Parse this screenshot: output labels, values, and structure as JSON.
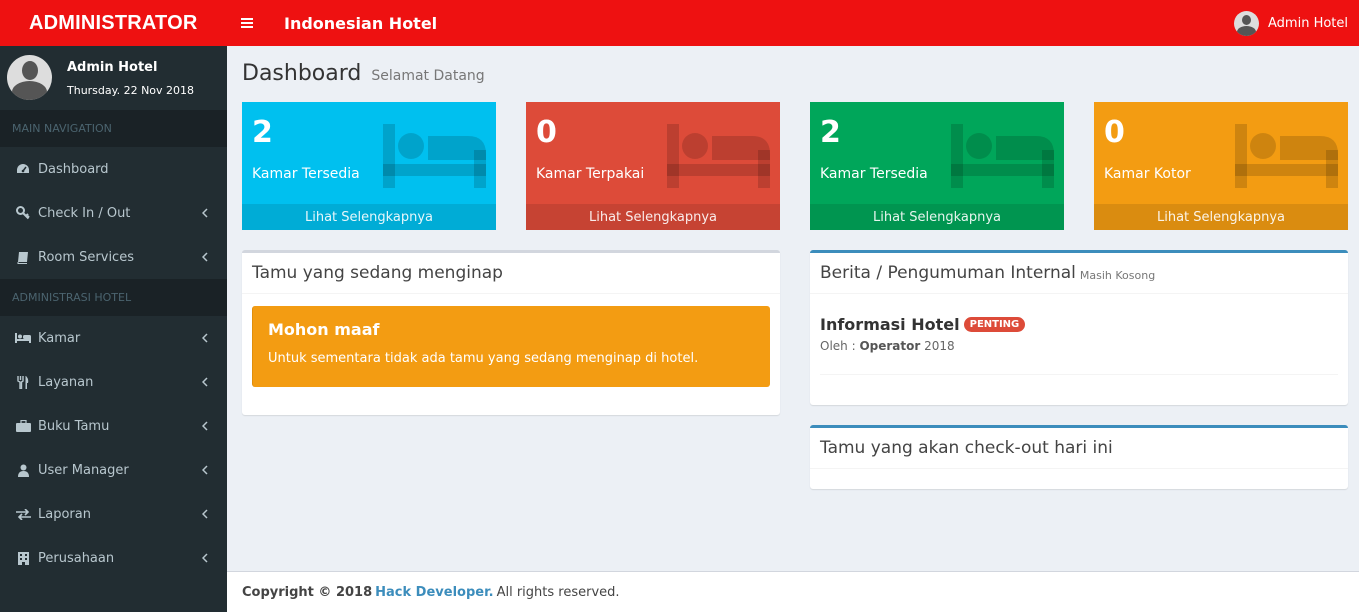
{
  "header": {
    "logo": "ADMINISTRATOR",
    "brand": "Indonesian Hotel",
    "user_name": "Admin Hotel",
    "color": "#ee1111"
  },
  "sidebar": {
    "user_name": "Admin Hotel",
    "user_date": "Thursday. 22 Nov 2018",
    "sections": [
      {
        "header": "MAIN NAVIGATION",
        "items": [
          {
            "label": "Dashboard",
            "icon": "dashboard-icon"
          },
          {
            "label": "Check In / Out",
            "icon": "key-icon"
          },
          {
            "label": "Room Services",
            "icon": "book-icon"
          }
        ]
      },
      {
        "header": "ADMINISTRASI HOTEL",
        "items": [
          {
            "label": "Kamar",
            "icon": "bed-icon"
          },
          {
            "label": "Layanan",
            "icon": "cutlery-icon"
          },
          {
            "label": "Buku Tamu",
            "icon": "briefcase-icon"
          },
          {
            "label": "User Manager",
            "icon": "user-icon"
          },
          {
            "label": "Laporan",
            "icon": "exchange-icon"
          },
          {
            "label": "Perusahaan",
            "icon": "building-icon"
          }
        ]
      }
    ]
  },
  "page": {
    "title": "Dashboard",
    "subtitle": "Selamat Datang"
  },
  "stats": [
    {
      "value": "2",
      "label": "Kamar Tersedia",
      "link": "Lihat Selengkapnya",
      "color": "#00c0ef",
      "icon": "bed-icon"
    },
    {
      "value": "0",
      "label": "Kamar Terpakai",
      "link": "Lihat Selengkapnya",
      "color": "#dd4b39",
      "icon": "bed-icon"
    },
    {
      "value": "2",
      "label": "Kamar Tersedia",
      "link": "Lihat Selengkapnya",
      "color": "#00a65a",
      "icon": "bed-icon"
    },
    {
      "value": "0",
      "label": "Kamar Kotor",
      "link": "Lihat Selengkapnya",
      "color": "#f39c12",
      "icon": "bed-icon"
    }
  ],
  "guests_box": {
    "title": "Tamu yang sedang menginap",
    "alert_title": "Mohon maaf",
    "alert_text": "Untuk sementara tidak ada tamu yang sedang menginap di hotel."
  },
  "news_box": {
    "title": "Berita / Pengumuman Internal",
    "subtitle": "Masih Kosong",
    "item_title": "Informasi Hotel",
    "item_badge": "PENTING",
    "meta_prefix": "Oleh :",
    "meta_author": "Operator",
    "meta_year": "2018"
  },
  "checkout_box": {
    "title": "Tamu yang akan check-out hari ini"
  },
  "footer": {
    "copyright": "Copyright © 2018",
    "link": "Hack Developer.",
    "suffix": "All rights reserved."
  }
}
